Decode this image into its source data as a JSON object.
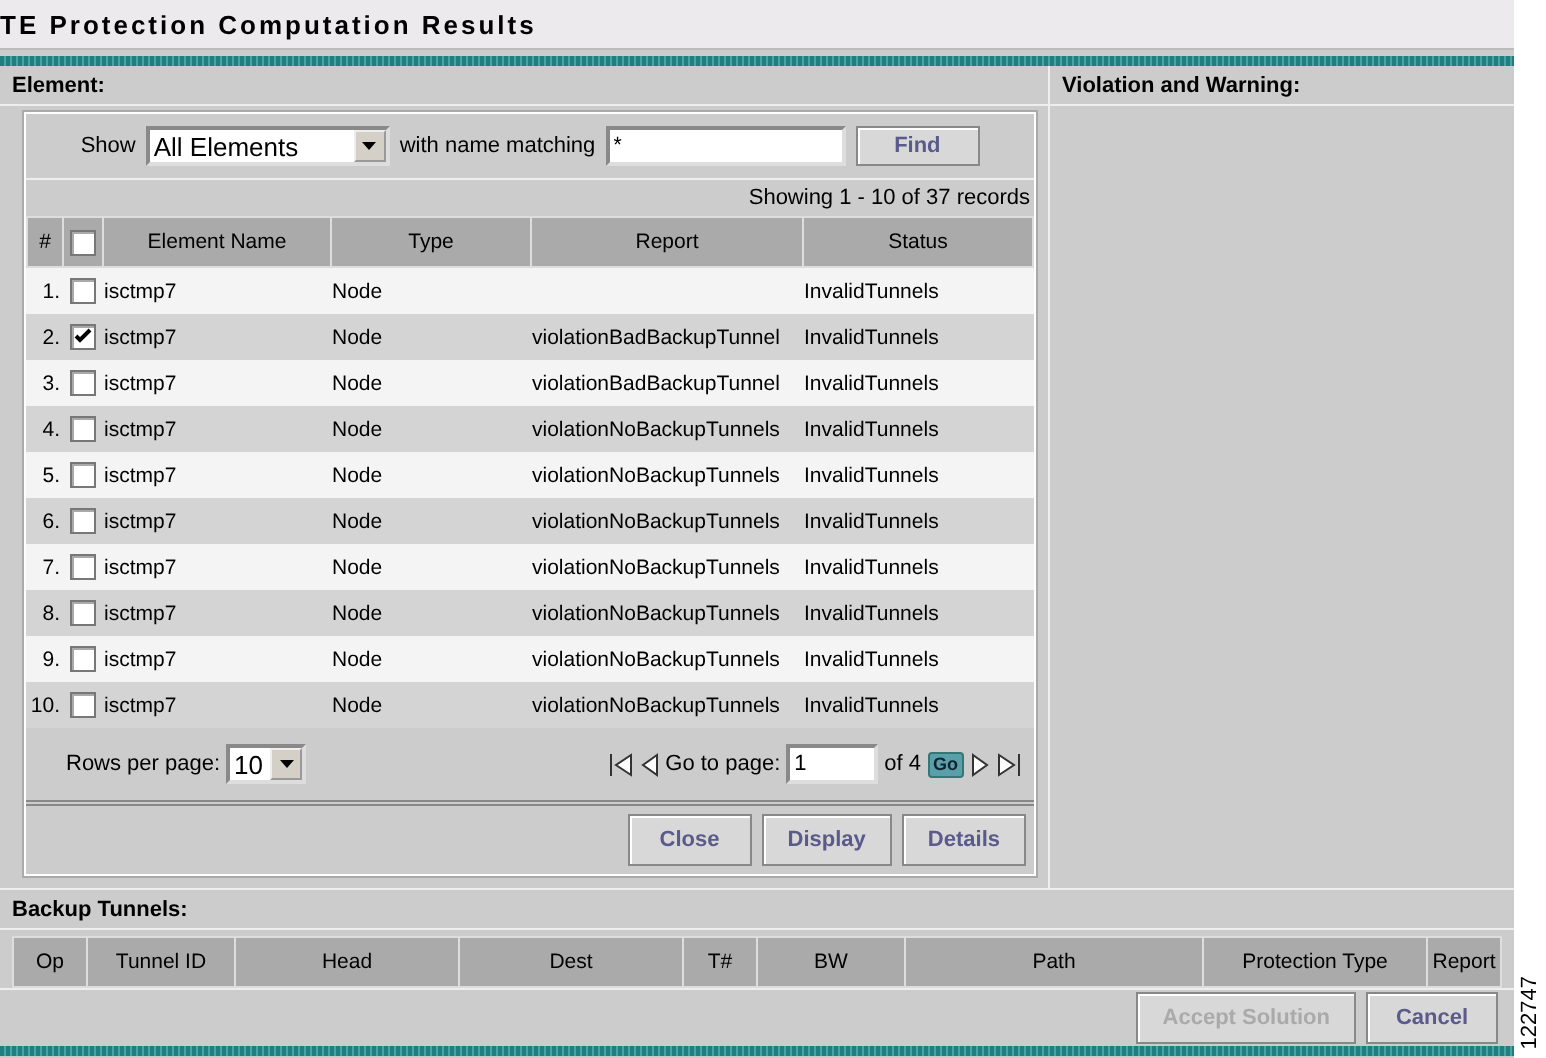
{
  "title": "TE Protection Computation Results",
  "element_panel": {
    "heading": "Element:",
    "filter": {
      "show_label": "Show",
      "show_value": "All Elements",
      "match_label": "with name matching",
      "match_value": "*",
      "find_button": "Find"
    },
    "record_count": "Showing 1 - 10 of 37 records",
    "table": {
      "columns": [
        "#",
        "Element Name",
        "Type",
        "Report",
        "Status"
      ],
      "all_checked": false,
      "rows": [
        {
          "index": "1.",
          "checked": false,
          "name": "isctmp7",
          "type": "Node",
          "report": "",
          "status": "InvalidTunnels"
        },
        {
          "index": "2.",
          "checked": true,
          "name": "isctmp7",
          "type": "Node",
          "report": "violationBadBackupTunnel",
          "status": "InvalidTunnels"
        },
        {
          "index": "3.",
          "checked": false,
          "name": "isctmp7",
          "type": "Node",
          "report": "violationBadBackupTunnel",
          "status": "InvalidTunnels"
        },
        {
          "index": "4.",
          "checked": false,
          "name": "isctmp7",
          "type": "Node",
          "report": "violationNoBackupTunnels",
          "status": "InvalidTunnels"
        },
        {
          "index": "5.",
          "checked": false,
          "name": "isctmp7",
          "type": "Node",
          "report": "violationNoBackupTunnels",
          "status": "InvalidTunnels"
        },
        {
          "index": "6.",
          "checked": false,
          "name": "isctmp7",
          "type": "Node",
          "report": "violationNoBackupTunnels",
          "status": "InvalidTunnels"
        },
        {
          "index": "7.",
          "checked": false,
          "name": "isctmp7",
          "type": "Node",
          "report": "violationNoBackupTunnels",
          "status": "InvalidTunnels"
        },
        {
          "index": "8.",
          "checked": false,
          "name": "isctmp7",
          "type": "Node",
          "report": "violationNoBackupTunnels",
          "status": "InvalidTunnels"
        },
        {
          "index": "9.",
          "checked": false,
          "name": "isctmp7",
          "type": "Node",
          "report": "violationNoBackupTunnels",
          "status": "InvalidTunnels"
        },
        {
          "index": "10.",
          "checked": false,
          "name": "isctmp7",
          "type": "Node",
          "report": "violationNoBackupTunnels",
          "status": "InvalidTunnels"
        }
      ]
    },
    "pagination": {
      "rows_label": "Rows per page:",
      "rows_value": "10",
      "goto_label": "Go to page:",
      "page_value": "1",
      "of_pages": "of 4",
      "go_button": "Go"
    },
    "buttons": [
      {
        "label": "Close",
        "disabled": false
      },
      {
        "label": "Display",
        "disabled": false
      },
      {
        "label": "Details",
        "disabled": false
      }
    ]
  },
  "violation_panel": {
    "heading": "Violation and Warning:"
  },
  "backup_tunnels": {
    "heading": "Backup Tunnels:",
    "columns": [
      "Op",
      "Tunnel ID",
      "Head",
      "Dest",
      "T#",
      "BW",
      "Path",
      "Protection Type",
      "Report"
    ]
  },
  "buttons": [
    {
      "label": "Accept Solution",
      "disabled": true
    },
    {
      "label": "Cancel",
      "disabled": false
    }
  ],
  "figure_id": "122747"
}
